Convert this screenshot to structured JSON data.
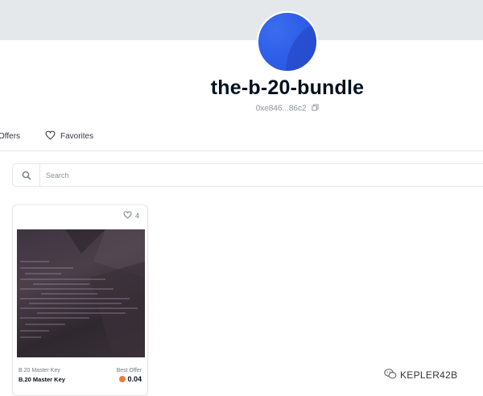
{
  "collection": {
    "name": "the-b-20-bundle",
    "address": "0xe846...86c2",
    "avatar_colors": [
      "#3b6df0",
      "#2a52d6"
    ]
  },
  "tabs": [
    {
      "label": "Offers",
      "icon": "none"
    },
    {
      "label": "Favorites",
      "icon": "heart-icon"
    }
  ],
  "search": {
    "placeholder": "Search",
    "icon": "search-icon"
  },
  "items": [
    {
      "favorites_count": "4",
      "collection_label": "B.20 Master Key",
      "name": "B.20 Master Key",
      "offer_label": "Best Offer",
      "price": "0.04",
      "currency_icon": "weth-icon"
    }
  ],
  "watermark": {
    "text": "KEPLER42B",
    "icon": "wechat-icon"
  },
  "colors": {
    "banner": "#e5e8eb",
    "text_primary": "#04111d",
    "text_muted": "#8a939b",
    "border": "#e5e8eb",
    "weth": "#e87d3e"
  }
}
